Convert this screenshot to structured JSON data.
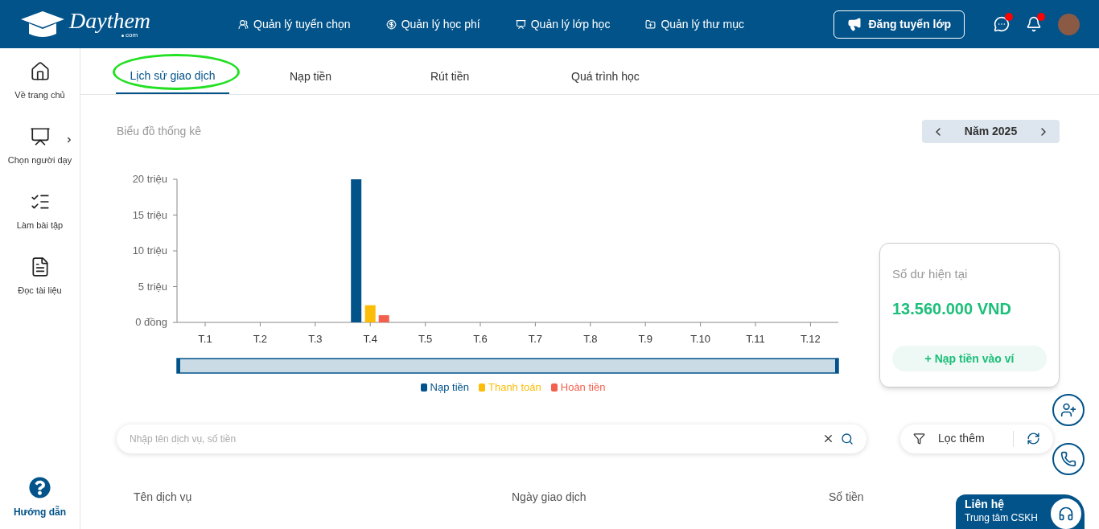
{
  "header": {
    "logo": {
      "name": "Daythem",
      "suffix": "com"
    },
    "nav": [
      {
        "kind": "users",
        "label": "Quản lý tuyển chọn"
      },
      {
        "kind": "fee",
        "label": "Quản lý học phí"
      },
      {
        "kind": "class",
        "label": "Quản lý lớp học"
      },
      {
        "kind": "folder",
        "label": "Quản lý thư mục"
      }
    ],
    "post_button": "Đăng tuyển lớp",
    "notifications": [
      {
        "kind": "chat",
        "badge": true
      },
      {
        "kind": "bell",
        "badge": true
      }
    ]
  },
  "sidebar": {
    "items": [
      {
        "kind": "home",
        "label": "Về trang chủ",
        "expandable": false
      },
      {
        "kind": "teacher",
        "label": "Chọn người dạy",
        "expandable": true
      },
      {
        "kind": "exercise",
        "label": "Làm bài tập",
        "expandable": false
      },
      {
        "kind": "pdf",
        "label": "Đọc tài liệu",
        "expandable": false
      }
    ],
    "help": "Hướng dẫn"
  },
  "tabs": [
    {
      "label": "Lịch sử giao dịch",
      "selected": true,
      "circled": true
    },
    {
      "label": "Nạp tiền",
      "selected": false,
      "circled": false
    },
    {
      "label": "Rút tiền",
      "selected": false,
      "circled": false
    },
    {
      "label": "Quá trình học",
      "selected": false,
      "circled": false
    }
  ],
  "statistics": {
    "title": "Biểu đồ thống kê",
    "year": "Năm 2025",
    "chart_data": {
      "type": "bar",
      "categories": [
        "T.1",
        "T.2",
        "T.3",
        "T.4",
        "T.5",
        "T.6",
        "T.7",
        "T.8",
        "T.9",
        "T.10",
        "T.11",
        "T.12"
      ],
      "series": [
        {
          "name": "Nạp tiền",
          "color": "#02538a",
          "values": [
            0,
            0,
            0,
            20,
            0,
            0,
            0,
            0,
            0,
            0,
            0,
            0
          ]
        },
        {
          "name": "Thanh toán",
          "color": "#fbbd08",
          "values": [
            0,
            0,
            0,
            2.4,
            0,
            0,
            0,
            0,
            0,
            0,
            0,
            0
          ]
        },
        {
          "name": "Hoàn tiền",
          "color": "#f4604e",
          "values": [
            0,
            0,
            0,
            1,
            0,
            0,
            0,
            0,
            0,
            0,
            0,
            0
          ]
        }
      ],
      "ylim": [
        0,
        20
      ],
      "legend": "bottom",
      "yticks": [
        {
          "value": 0,
          "label": "0 đồng"
        },
        {
          "value": 5,
          "label": "5 triệu"
        },
        {
          "value": 10,
          "label": "10 triệu"
        },
        {
          "value": 15,
          "label": "15 triệu"
        },
        {
          "value": 20,
          "label": "20 triệu"
        }
      ]
    }
  },
  "balance": {
    "label": "Số dư hiện tại",
    "amount": "13.560.000 VND",
    "button": "+ Nạp tiền vào ví"
  },
  "search": {
    "placeholder": "Nhập tên dịch vụ, số tiền"
  },
  "filter_button": "Lọc thêm",
  "table": {
    "columns": [
      "Tên dịch vụ",
      "Ngày giao dịch",
      "Số tiền"
    ]
  },
  "contact": {
    "title": "Liên hệ",
    "subtitle": "Trung tâm CSKH"
  }
}
